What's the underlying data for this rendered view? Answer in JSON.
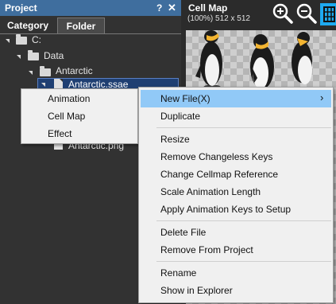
{
  "project_panel": {
    "title": "Project",
    "pin_glyph": "?",
    "close_glyph": "✕",
    "tabs": {
      "category": "Category",
      "folder": "Folder"
    },
    "tree": {
      "drive": "C:",
      "data": "Data",
      "antarctic_folder": "Antarctic",
      "ssae_file": "Antarctic.ssae",
      "png_file": "Antarctic.png"
    }
  },
  "cellmap_panel": {
    "title": "Cell Map",
    "info": "(100%) 512 x 512"
  },
  "submenu": {
    "items": [
      "Animation",
      "Cell Map",
      "Effect"
    ]
  },
  "context_menu": {
    "new_file": "New File(X)",
    "new_file_arrow": "›",
    "duplicate": "Duplicate",
    "resize": "Resize",
    "remove_changeless_keys": "Remove Changeless Keys",
    "change_cellmap_reference": "Change Cellmap Reference",
    "scale_animation_length": "Scale Animation Length",
    "apply_animation_keys": "Apply Animation Keys to Setup",
    "delete_file": "Delete File",
    "remove_from_project": "Remove From Project",
    "rename": "Rename",
    "show_in_explorer": "Show in Explorer"
  },
  "colors": {
    "title_bar": "#3f6e9e",
    "selection": "#1f3f72",
    "menu_highlight": "#91c9f7",
    "grid_button": "#1ea9f0"
  }
}
